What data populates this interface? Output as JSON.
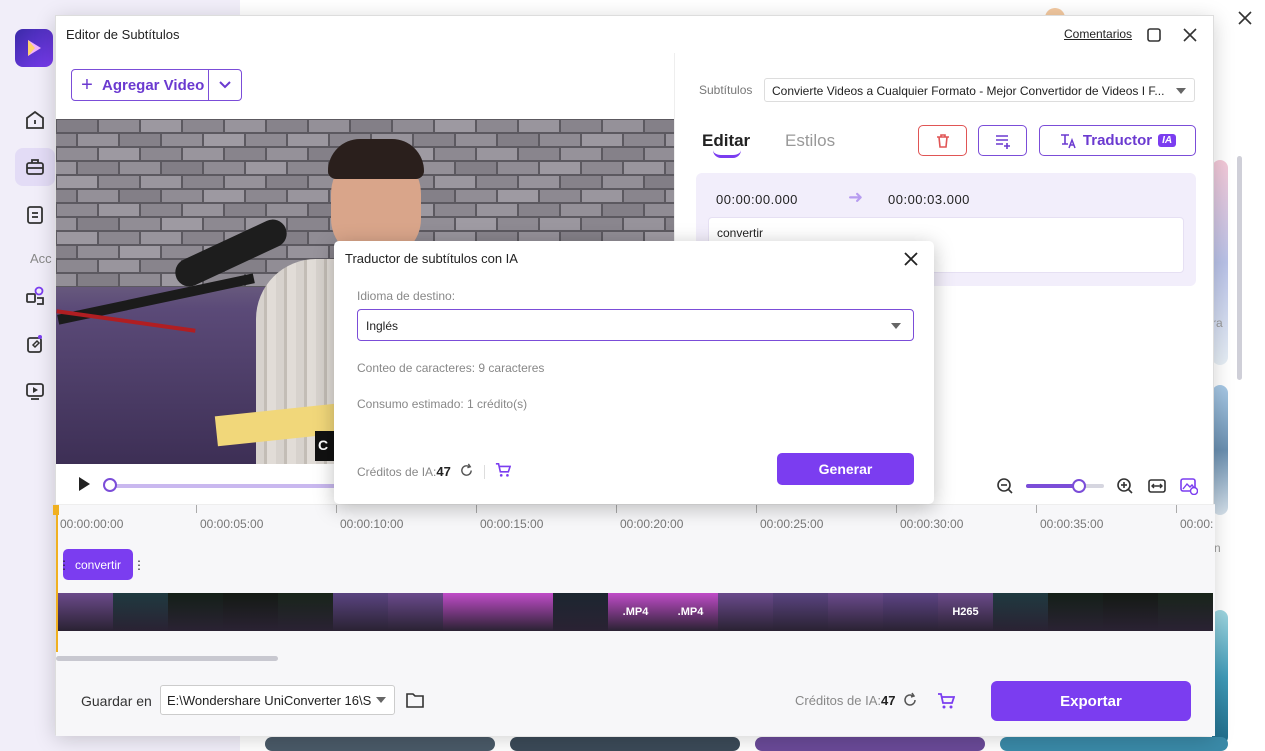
{
  "background": {
    "sidebar_partial_label": "Acc",
    "edge_text_1": "ra",
    "edge_text_2": "n"
  },
  "window": {
    "title": "Editor de Subtítulos",
    "feedback_link": "Comentarios"
  },
  "toolbar": {
    "add_video_label": "Agregar Video"
  },
  "video": {
    "corner_text": "C"
  },
  "timeline": {
    "ticks": [
      "00:00:00:00",
      "00:00:05:00",
      "00:00:10:00",
      "00:00:15:00",
      "00:00:20:00",
      "00:00:25:00",
      "00:00:30:00",
      "00:00:35:00",
      "00:00:"
    ],
    "clip_label": "convertir",
    "frames": [
      "",
      "",
      "",
      "",
      "",
      "",
      "",
      "",
      "",
      "",
      ".MP4",
      ".MP4",
      "",
      "",
      "",
      "",
      "H265",
      "",
      "",
      "",
      ""
    ]
  },
  "bottom": {
    "save_label": "Guardar en",
    "save_path": "E:\\Wondershare UniConverter 16\\S",
    "credits_label": "Créditos de IA:",
    "credits_value": "47",
    "export_label": "Exportar"
  },
  "right_panel": {
    "subtitles_label": "Subtítulos",
    "subtitles_value": "Convierte Videos a Cualquier Formato - Mejor Convertidor de Videos I F...",
    "tab_edit": "Editar",
    "tab_styles": "Estilos",
    "translator_label": "Traductor",
    "ia_badge": "IA",
    "start_time": "00:00:00.000",
    "end_time": "00:00:03.000",
    "subtitle_text": "convertir"
  },
  "dialog": {
    "title": "Traductor de subtítulos con IA",
    "target_language_label": "Idioma de destino:",
    "target_language_value": "Inglés",
    "char_count": "Conteo de caracteres:  9 caracteres",
    "estimated_consumption": "Consumo estimado:   1 crédito(s)",
    "credits_label": "Créditos de IA:",
    "credits_value": "47",
    "generate_label": "Generar"
  },
  "colors": {
    "accent": "#7b3df0",
    "danger": "#e05555"
  }
}
